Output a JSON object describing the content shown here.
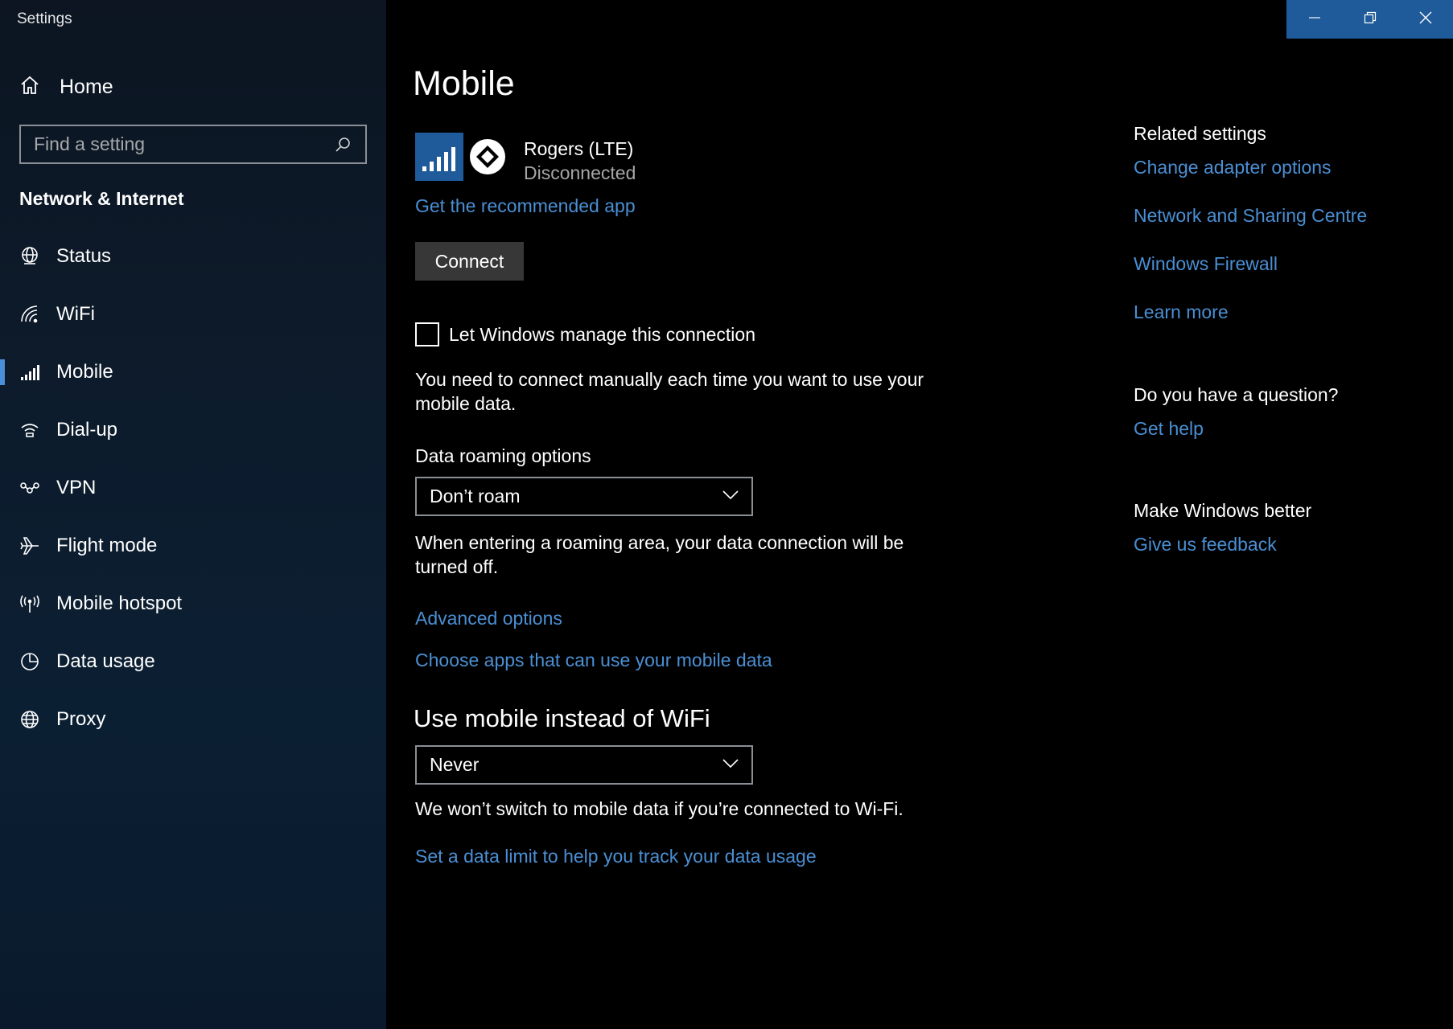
{
  "window": {
    "title": "Settings",
    "controls": {
      "minimize": "minimize-icon",
      "restore": "restore-icon",
      "close": "close-icon"
    },
    "accent_color": "#1f5b9a"
  },
  "sidebar": {
    "home_label": "Home",
    "search": {
      "placeholder": "Find a setting",
      "value": ""
    },
    "section_title": "Network & Internet",
    "items": [
      {
        "label": "Status",
        "icon": "globe-status-icon",
        "active": false
      },
      {
        "label": "WiFi",
        "icon": "wifi-icon",
        "active": false
      },
      {
        "label": "Mobile",
        "icon": "cellular-signal-icon",
        "active": true
      },
      {
        "label": "Dial-up",
        "icon": "dial-up-icon",
        "active": false
      },
      {
        "label": "VPN",
        "icon": "vpn-icon",
        "active": false
      },
      {
        "label": "Flight mode",
        "icon": "airplane-icon",
        "active": false
      },
      {
        "label": "Mobile hotspot",
        "icon": "hotspot-icon",
        "active": false
      },
      {
        "label": "Data usage",
        "icon": "pie-chart-icon",
        "active": false
      },
      {
        "label": "Proxy",
        "icon": "globe-icon",
        "active": false
      }
    ]
  },
  "main": {
    "title": "Mobile",
    "connection": {
      "name": "Rogers (LTE)",
      "status": "Disconnected",
      "recommended_app_link": "Get the recommended app",
      "connect_button": "Connect"
    },
    "manage": {
      "label": "Let Windows manage this connection",
      "checked": false,
      "description": "You need to connect manually each time you want to use your mobile data."
    },
    "roaming": {
      "label": "Data roaming options",
      "selected": "Don’t roam",
      "description": "When entering a roaming area, your data connection will be turned off."
    },
    "links": {
      "advanced": "Advanced options",
      "choose_apps": "Choose apps that can use your mobile data"
    },
    "wifi_section": {
      "title": "Use mobile instead of WiFi",
      "selected": "Never",
      "description": "We won’t switch to mobile data if you’re connected to Wi-Fi.",
      "data_limit_link": "Set a data limit to help you track your data usage"
    }
  },
  "related": {
    "heading": "Related settings",
    "links": [
      "Change adapter options",
      "Network and Sharing Centre",
      "Windows Firewall",
      "Learn more"
    ],
    "question_heading": "Do you have a question?",
    "get_help": "Get help",
    "better_heading": "Make Windows better",
    "feedback": "Give us feedback"
  }
}
